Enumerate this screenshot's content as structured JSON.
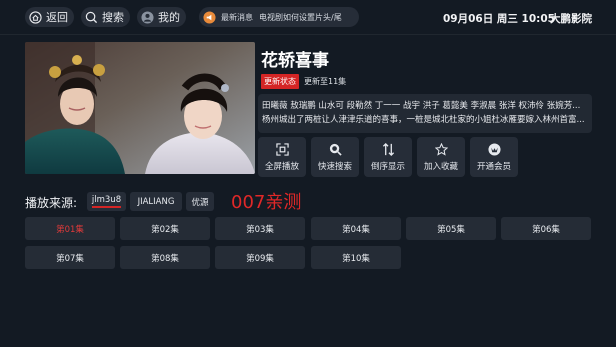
{
  "topbar": {
    "back_label": "返回",
    "search_label": "搜索",
    "mine_label": "我的",
    "notice_label": "最新消息",
    "notice_text": "电视剧如何设置片头/尾",
    "clock": "09月06日 周三 10:05",
    "brand": "大鹏影院"
  },
  "detail": {
    "title": "花轿喜事",
    "status_tag": "更新状态",
    "status_text": "更新至11集",
    "synopsis_lines": [
      "田曦薇 敖瑞鹏 山水可 段勒然 丁一一 战宇 洪子 葛懿美 李淑晨 张洋 权沛伶 张婉芳...",
      "杨州城出了两桩让人津津乐道的喜事，一桩是城北杜家的小姐杜冰雁要嫁入林州首富..."
    ]
  },
  "actions": [
    {
      "label": "全屏播放",
      "icon": "fullscreen-icon"
    },
    {
      "label": "快速搜索",
      "icon": "search-icon"
    },
    {
      "label": "倒序显示",
      "icon": "sort-icon"
    },
    {
      "label": "加入收藏",
      "icon": "star-icon"
    },
    {
      "label": "开通会员",
      "icon": "vip-icon"
    }
  ],
  "source": {
    "label": "播放来源:",
    "options": [
      "jlm3u8",
      "JIALIANG",
      "优源"
    ],
    "selected": "jlm3u8",
    "tested_text": "007亲测"
  },
  "episodes": [
    "第01集",
    "第02集",
    "第03集",
    "第04集",
    "第05集",
    "第06集",
    "第07集",
    "第08集",
    "第09集",
    "第10集"
  ],
  "episode_selected": "第01集",
  "colors": {
    "background": "#131a23",
    "panel": "#262d38",
    "accent_red": "#d42525"
  }
}
